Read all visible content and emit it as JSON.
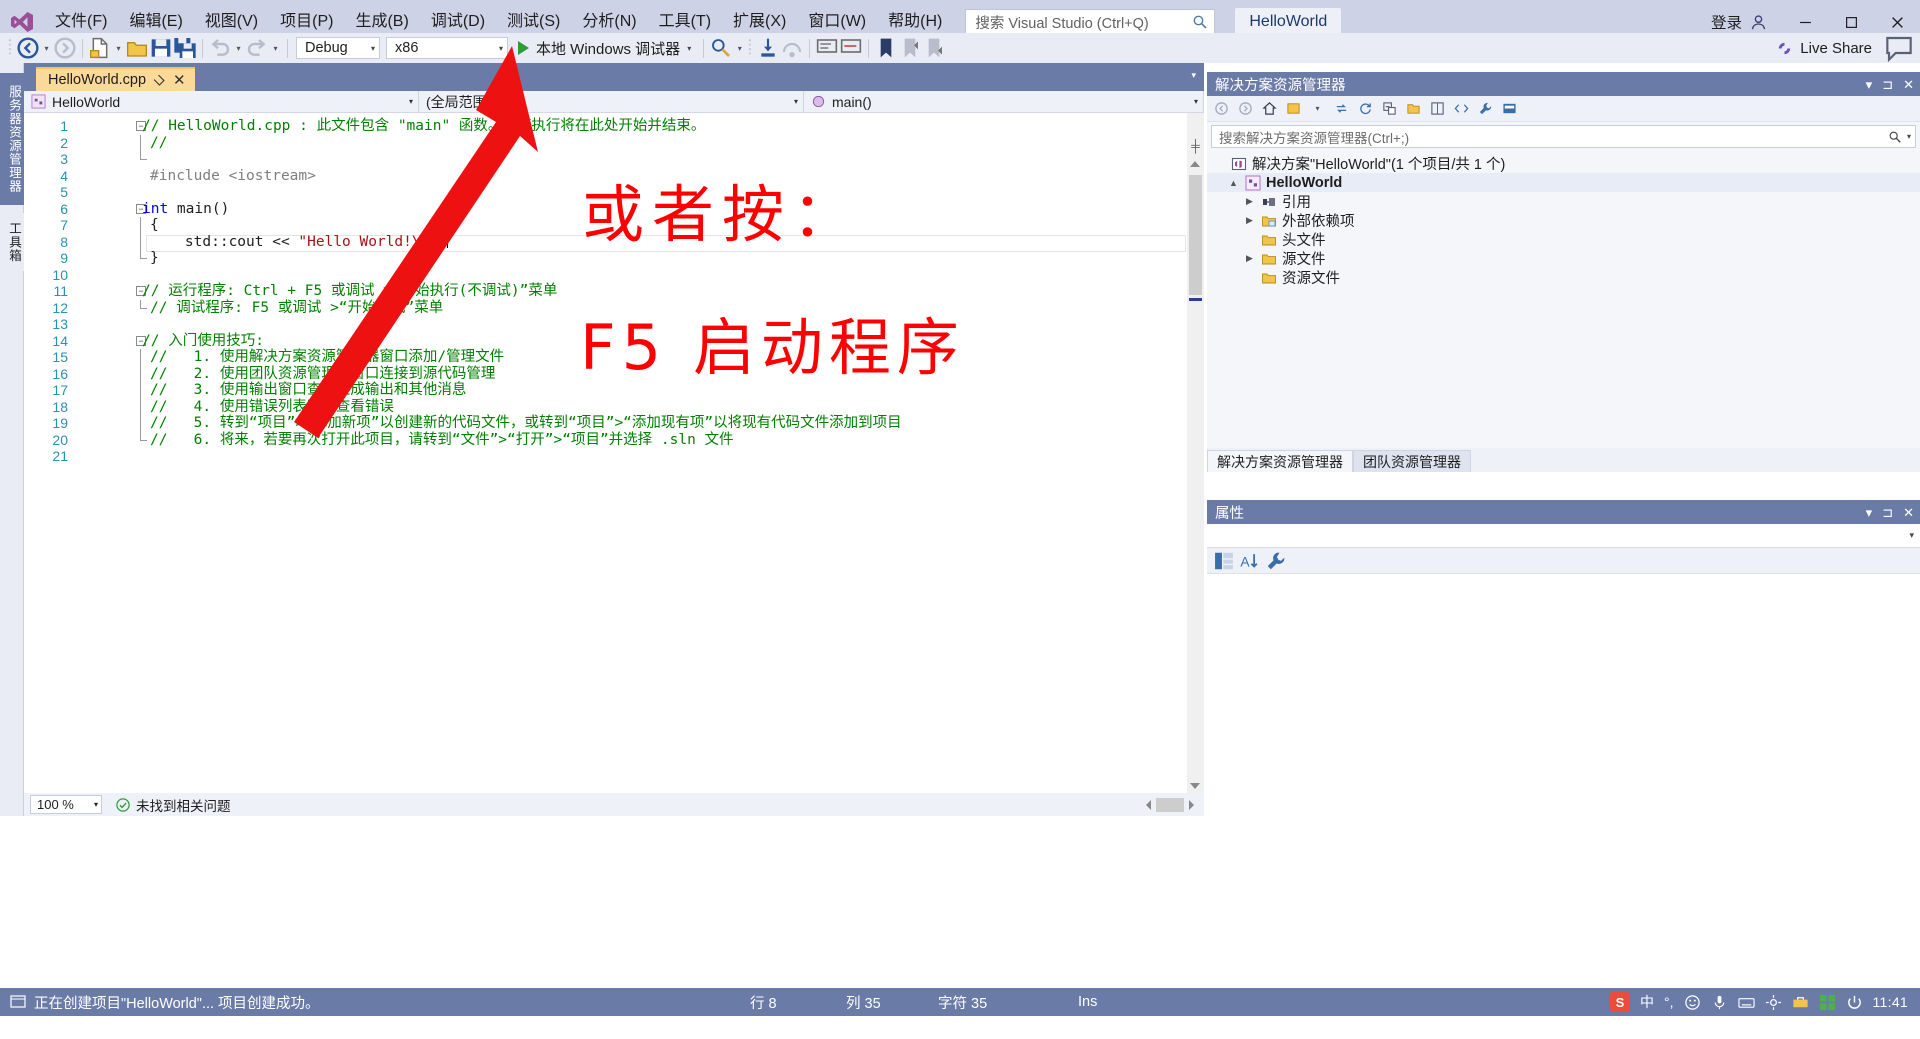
{
  "titlebar": {
    "logo_icon": "visual-studio-logo",
    "menus": [
      {
        "label": "文件(F)"
      },
      {
        "label": "编辑(E)"
      },
      {
        "label": "视图(V)"
      },
      {
        "label": "项目(P)"
      },
      {
        "label": "生成(B)"
      },
      {
        "label": "调试(D)"
      },
      {
        "label": "测试(S)"
      },
      {
        "label": "分析(N)"
      },
      {
        "label": "工具(T)"
      },
      {
        "label": "扩展(X)"
      },
      {
        "label": "窗口(W)"
      },
      {
        "label": "帮助(H)"
      }
    ],
    "search_placeholder": "搜索 Visual Studio (Ctrl+Q)",
    "search_icon": "magnifier-icon",
    "project_pill": "HelloWorld",
    "signin_label": "登录",
    "signin_icon": "account-icon",
    "minimize_icon": "minimize-icon",
    "maximize_icon": "maximize-icon",
    "close_icon": "close-icon"
  },
  "toolbar": {
    "nav_back_icon": "navigate-back-icon",
    "nav_forward_icon": "navigate-forward-icon",
    "new_item_icon": "new-file-icon",
    "open_icon": "open-folder-icon",
    "save_icon": "save-icon",
    "save_all_icon": "save-all-icon",
    "undo_icon": "undo-icon",
    "redo_icon": "redo-icon",
    "config_value": "Debug",
    "platform_value": "x86",
    "run_label": "本地 Windows 调试器",
    "run_icon": "play-icon",
    "live_share_label": "Live Share",
    "live_share_icon": "live-share-icon",
    "feedback_icon": "feedback-icon"
  },
  "left_rail": {
    "tabs": [
      {
        "label": "服务器资源管理器"
      },
      {
        "label": "工具箱"
      }
    ]
  },
  "editor": {
    "tab": {
      "title": "HelloWorld.cpp",
      "pin_icon": "pin-icon",
      "close_icon": "close-icon"
    },
    "nav": {
      "project_value": "HelloWorld",
      "project_icon": "cpp-project-icon",
      "scope_value": "(全局范围)",
      "member_value": "main()",
      "member_icon": "method-icon"
    },
    "lines": [
      {
        "n": "1",
        "fold": "-",
        "indent": 0,
        "segs": [
          {
            "c": "cmt",
            "t": "// HelloWorld.cpp : 此文件包含 \"main\" 函数。程序执行将在此处开始并结束。"
          }
        ]
      },
      {
        "n": "2",
        "fold": "|",
        "indent": 1,
        "segs": [
          {
            "c": "cmt",
            "t": "//"
          }
        ]
      },
      {
        "n": "3",
        "fold": "e",
        "indent": 1,
        "segs": []
      },
      {
        "n": "4",
        "fold": "",
        "indent": 1,
        "segs": [
          {
            "c": "pp",
            "t": "#include <iostream>"
          }
        ]
      },
      {
        "n": "5",
        "fold": "",
        "indent": 1,
        "segs": []
      },
      {
        "n": "6",
        "fold": "-",
        "indent": 0,
        "segs": [
          {
            "c": "kw",
            "t": "int"
          },
          {
            "c": "pln",
            "t": " main()"
          }
        ]
      },
      {
        "n": "7",
        "fold": "|",
        "indent": 1,
        "segs": [
          {
            "c": "pln",
            "t": "{"
          }
        ]
      },
      {
        "n": "8",
        "fold": "|",
        "indent": 1,
        "segs": [
          {
            "c": "pln",
            "t": "    std::cout << "
          },
          {
            "c": "str",
            "t": "\"Hello World!\\n\""
          },
          {
            "c": "pln",
            "t": ";"
          }
        ]
      },
      {
        "n": "9",
        "fold": "e",
        "indent": 1,
        "segs": [
          {
            "c": "pln",
            "t": "}"
          }
        ]
      },
      {
        "n": "10",
        "fold": "",
        "indent": 1,
        "segs": []
      },
      {
        "n": "11",
        "fold": "-",
        "indent": 0,
        "segs": [
          {
            "c": "cmt",
            "t": "// 运行程序: Ctrl + F5 或调试 >“开始执行(不调试)”菜单"
          }
        ]
      },
      {
        "n": "12",
        "fold": "e",
        "indent": 1,
        "segs": [
          {
            "c": "cmt",
            "t": "// 调试程序: F5 或调试 >“开始调试”菜单"
          }
        ]
      },
      {
        "n": "13",
        "fold": "",
        "indent": 1,
        "segs": []
      },
      {
        "n": "14",
        "fold": "-",
        "indent": 0,
        "segs": [
          {
            "c": "cmt",
            "t": "// 入门使用技巧:"
          }
        ]
      },
      {
        "n": "15",
        "fold": "|",
        "indent": 1,
        "segs": [
          {
            "c": "cmt",
            "t": "//   1. 使用解决方案资源管理器窗口添加/管理文件"
          }
        ]
      },
      {
        "n": "16",
        "fold": "|",
        "indent": 1,
        "segs": [
          {
            "c": "cmt",
            "t": "//   2. 使用团队资源管理器窗口连接到源代码管理"
          }
        ]
      },
      {
        "n": "17",
        "fold": "|",
        "indent": 1,
        "segs": [
          {
            "c": "cmt",
            "t": "//   3. 使用输出窗口查看生成输出和其他消息"
          }
        ]
      },
      {
        "n": "18",
        "fold": "|",
        "indent": 1,
        "segs": [
          {
            "c": "cmt",
            "t": "//   4. 使用错误列表窗口查看错误"
          }
        ]
      },
      {
        "n": "19",
        "fold": "|",
        "indent": 1,
        "segs": [
          {
            "c": "cmt",
            "t": "//   5. 转到“项目”>“添加新项”以创建新的代码文件，或转到“项目”>“添加现有项”以将现有代码文件添加到项目"
          }
        ]
      },
      {
        "n": "20",
        "fold": "e",
        "indent": 1,
        "segs": [
          {
            "c": "cmt",
            "t": "//   6. 将来，若要再次打开此项目，请转到“文件”>“打开”>“项目”并选择 .sln 文件"
          }
        ]
      },
      {
        "n": "21",
        "fold": "",
        "indent": 1,
        "segs": []
      }
    ],
    "footer": {
      "zoom_value": "100 %",
      "issue_text": "未找到相关问题",
      "issue_icon": "check-circle-icon"
    }
  },
  "solution_explorer": {
    "title": "解决方案资源管理器",
    "dropdown_icon": "chevron-down-icon",
    "pin_icon": "pin-icon",
    "close_icon": "close-icon",
    "toolbar_icons": [
      "navigate-back-icon",
      "navigate-forward-icon",
      "home-icon",
      "pending-changes-icon",
      "sync-icon",
      "refresh-icon",
      "collapse-all-icon",
      "show-all-files-icon",
      "properties-icon",
      "code-view-icon",
      "wrench-icon",
      "preview-icon"
    ],
    "search_placeholder": "搜索解决方案资源管理器(Ctrl+;)",
    "search_icon": "magnifier-icon",
    "tree": [
      {
        "label": "解决方案\"HelloWorld\"(1 个项目/共 1 个)",
        "indent": 0,
        "twisty": "",
        "icon": "solution-icon",
        "bold": false
      },
      {
        "label": "HelloWorld",
        "indent": 1,
        "twisty": "▲",
        "icon": "cpp-project-icon",
        "bold": true
      },
      {
        "label": "引用",
        "indent": 2,
        "twisty": "▶",
        "icon": "references-icon",
        "bold": false
      },
      {
        "label": "外部依赖项",
        "indent": 2,
        "twisty": "▶",
        "icon": "folder-blue-icon",
        "bold": false
      },
      {
        "label": "头文件",
        "indent": 2,
        "twisty": "",
        "icon": "folder-icon",
        "bold": false
      },
      {
        "label": "源文件",
        "indent": 2,
        "twisty": "▶",
        "icon": "folder-icon",
        "bold": false
      },
      {
        "label": "资源文件",
        "indent": 2,
        "twisty": "",
        "icon": "folder-icon",
        "bold": false
      }
    ],
    "tabs": [
      {
        "label": "解决方案资源管理器",
        "active": true
      },
      {
        "label": "团队资源管理器",
        "active": false
      }
    ]
  },
  "properties": {
    "title": "属性",
    "dropdown_icon": "chevron-down-icon",
    "pin_icon": "pin-icon",
    "close_icon": "close-icon",
    "toolbar_icons": [
      "categorized-icon",
      "alphabetical-icon",
      "property-pages-icon"
    ]
  },
  "annotations": {
    "text_1": "或者按：",
    "text_2": "F5 启动程序",
    "arrow_color": "#ee1111"
  },
  "statusbar": {
    "message": "正在创建项目\"HelloWorld\"... 项目创建成功。",
    "message_icon": "status-icon",
    "line_label": "行 8",
    "col_label": "列 35",
    "char_label": "字符 35",
    "insert_label": "Ins"
  },
  "tray": {
    "ime_badge": "S",
    "ime_mode": "中",
    "ime_punct": "°,",
    "icons": [
      "smiley-icon",
      "microphone-icon",
      "keyboard-icon",
      "settings-icon",
      "toolbox-icon",
      "grid-icon",
      "power-icon"
    ],
    "clock": "11:41"
  },
  "colors": {
    "chrome": "#cdd2e6",
    "accent": "#6b7ba8",
    "tab_active": "#fbd999",
    "comment": "#008000",
    "keyword": "#0000ff",
    "string": "#a31515",
    "linenumber": "#2b91af",
    "annotation_red": "#ff0000"
  }
}
